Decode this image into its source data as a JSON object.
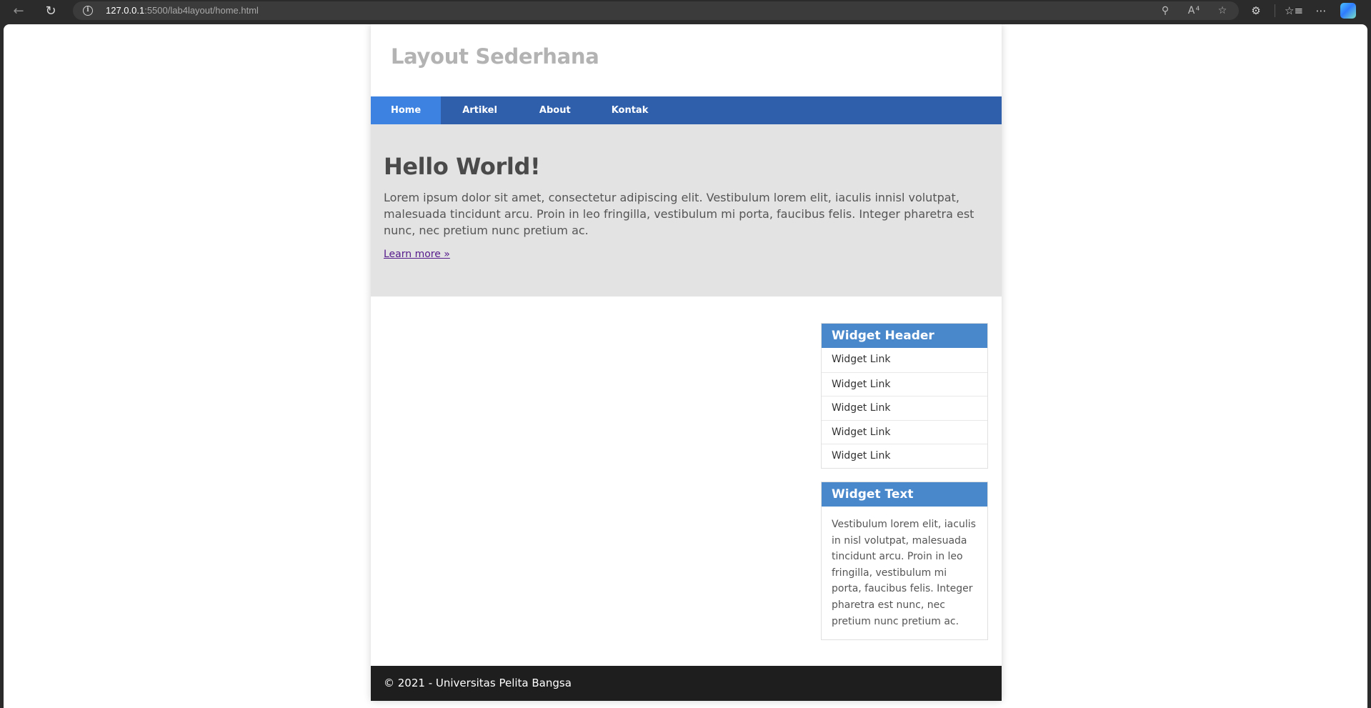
{
  "browser": {
    "url_host": "127.0.0.1",
    "url_rest": ":5500/lab4layout/home.html"
  },
  "site": {
    "title": "Layout Sederhana",
    "nav": [
      "Home",
      "Artikel",
      "About",
      "Kontak"
    ],
    "active_nav": "Home"
  },
  "hero": {
    "title": "Hello World!",
    "text": "Lorem ipsum dolor sit amet, consectetur adipiscing elit. Vestibulum lorem elit, iaculis innisl volutpat, malesuada tincidunt arcu. Proin in leo fringilla, vestibulum mi porta, faucibus felis. Integer pharetra est nunc, nec pretium nunc pretium ac.",
    "link": "Learn more »"
  },
  "sidebar": {
    "widget1": {
      "header": "Widget Header",
      "links": [
        "Widget Link",
        "Widget Link",
        "Widget Link",
        "Widget Link",
        "Widget Link"
      ]
    },
    "widget2": {
      "header": "Widget Text",
      "text": "Vestibulum lorem elit, iaculis in nisl volutpat, malesuada tincidunt arcu. Proin in leo fringilla, vestibulum mi porta, faucibus felis. Integer pharetra est nunc, nec pretium nunc pretium ac."
    }
  },
  "footer": {
    "text": "© 2021 - Universitas Pelita Bangsa"
  },
  "colors": {
    "nav_bg": "#2f5fab",
    "nav_active": "#3d82e0",
    "hero_bg": "#e3e3e3",
    "widget_head": "#4a88cc",
    "footer_bg": "#1e1e1e"
  }
}
